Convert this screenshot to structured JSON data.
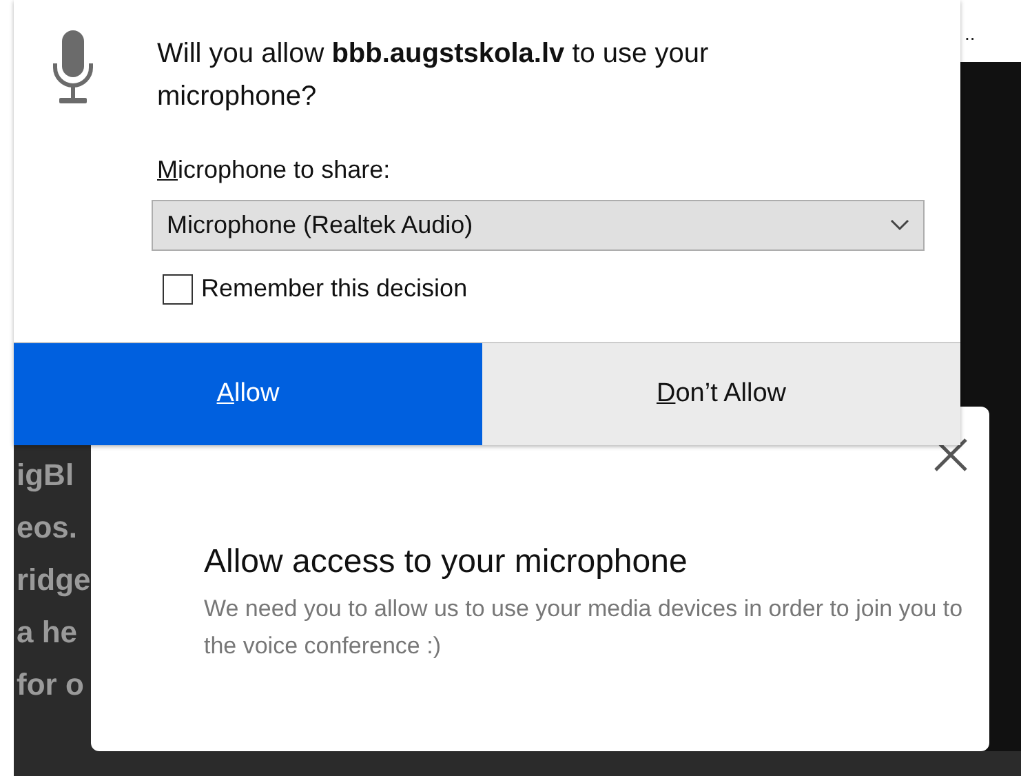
{
  "page": {
    "corner_text": "..",
    "fragments": [
      "igBl",
      "eos.",
      "ridge",
      "a he",
      "for o"
    ]
  },
  "prompt": {
    "message": "Will you allow **bbb.augstskola.lv** to use your microphone?",
    "device_label": "Microphone to share:",
    "device_select": {
      "value": "Microphone (Realtek Audio)"
    },
    "remember": {
      "label": "Remember this decision",
      "checked": false
    },
    "buttons": [
      {
        "label": "Allow",
        "kind": "primary"
      },
      {
        "label": "Don’t Allow",
        "kind": "secondary"
      }
    ]
  },
  "modal": {
    "title": "Allow access to your microphone",
    "text": "We need you to allow us to use your media devices in order to join you to the voice conference :)"
  }
}
